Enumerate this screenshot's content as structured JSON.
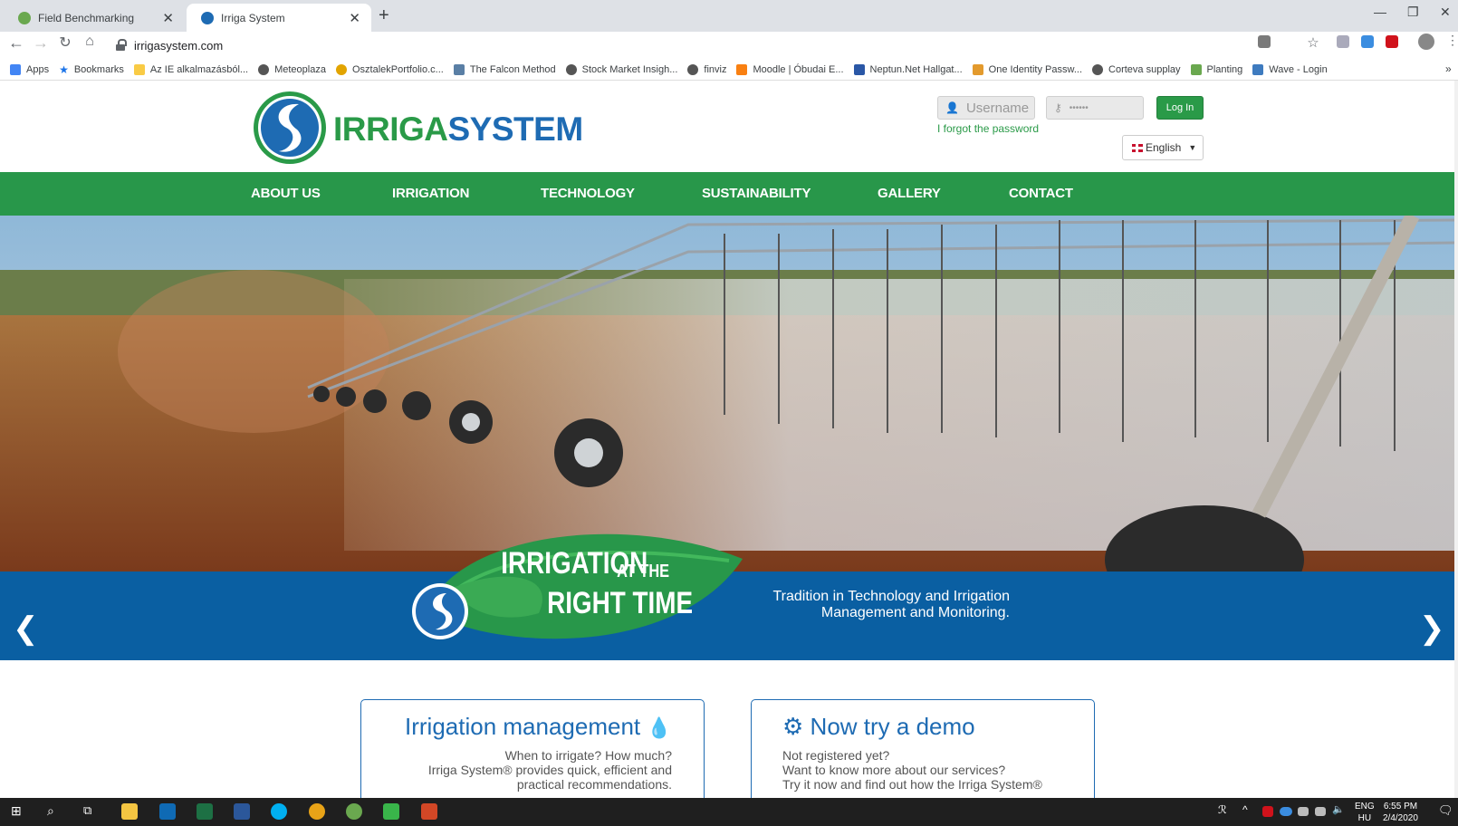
{
  "browser": {
    "tabs": [
      {
        "title": "Field Benchmarking",
        "active": false
      },
      {
        "title": "Irriga System",
        "active": true
      }
    ],
    "url": "irrigasystem.com",
    "bookmarks": [
      "Apps",
      "Bookmarks",
      "Az IE alkalmazásból...",
      "Meteoplaza",
      "OsztalekPortfolio.c...",
      "The Falcon Method",
      "Stock Market Insigh...",
      "finviz",
      "Moodle | Óbudai E...",
      "Neptun.Net Hallgat...",
      "One Identity Passw...",
      "Corteva supplay",
      "Planting",
      "Wave - Login"
    ]
  },
  "site": {
    "brand": {
      "part1": "IRRIGA",
      "part2": "SYSTEM"
    },
    "login": {
      "username_placeholder": "Username",
      "password_placeholder": "••••••",
      "button": "Log In",
      "forgot": "I forgot the password",
      "language": "English"
    },
    "nav": [
      "ABOUT US",
      "IRRIGATION",
      "TECHNOLOGY",
      "SUSTAINABILITY",
      "GALLERY",
      "CONTACT"
    ],
    "hero": {
      "slogan_big1": "IRRIGATION",
      "slogan_small": "AT THE",
      "slogan_big2": "RIGHT TIME",
      "tagline_line1": "Tradition in Technology and Irrigation",
      "tagline_line2": "Management and Monitoring."
    },
    "cards": [
      {
        "title": "Irrigation management",
        "lines": [
          "When to irrigate? How much?",
          "Irriga System® provides quick, efficient and",
          "practical recommendations."
        ]
      },
      {
        "title": "Now try a demo",
        "lines": [
          "Not registered yet?",
          "Want to know more about our services?",
          "Try it now and find out how the Irriga System®"
        ]
      }
    ]
  },
  "taskbar": {
    "lang_line1": "ENG",
    "lang_line2": "HU",
    "time": "6:55 PM",
    "date": "2/4/2020"
  },
  "colors": {
    "green": "#28974a",
    "blue": "#0a5fa2",
    "brand_blue": "#1e6bb3"
  }
}
